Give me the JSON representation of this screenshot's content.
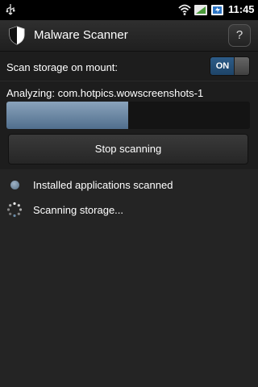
{
  "status_bar": {
    "time": "11:45",
    "icons": [
      "usb-icon",
      "wifi-icon",
      "signal-icon",
      "battery-icon"
    ]
  },
  "app_bar": {
    "title": "Malware Scanner",
    "help_label": "?",
    "icon": "shield-icon"
  },
  "settings": {
    "scan_on_mount_label": "Scan storage on mount:",
    "scan_on_mount_state": "ON"
  },
  "scan": {
    "analyzing_text": "Analyzing: com.hotpics.wowscreenshots-1",
    "progress_fraction": 0.5,
    "stop_button_label": "Stop scanning"
  },
  "status_items": [
    {
      "label": "Installed applications scanned",
      "icon": "complete-dot-icon"
    },
    {
      "label": "Scanning storage...",
      "icon": "spinner-icon"
    }
  ],
  "colors": {
    "accent": "#2d5c88",
    "progress": "#6f8aa6",
    "background": "#1d1d1d"
  }
}
